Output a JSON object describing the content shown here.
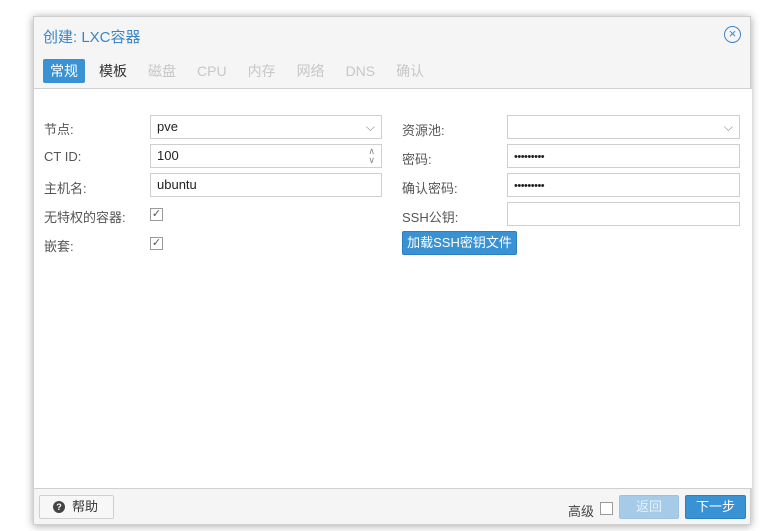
{
  "dialog": {
    "title": "创建: LXC容器",
    "close_glyph": "×",
    "tabs": [
      {
        "label": "常规",
        "active": true,
        "enabled": true
      },
      {
        "label": "模板",
        "active": false,
        "enabled": true
      },
      {
        "label": "磁盘",
        "active": false,
        "enabled": false
      },
      {
        "label": "CPU",
        "active": false,
        "enabled": false
      },
      {
        "label": "内存",
        "active": false,
        "enabled": false
      },
      {
        "label": "网络",
        "active": false,
        "enabled": false
      },
      {
        "label": "DNS",
        "active": false,
        "enabled": false
      },
      {
        "label": "确认",
        "active": false,
        "enabled": false
      }
    ]
  },
  "form": {
    "node_label": "节点:",
    "node_value": "pve",
    "ctid_label": "CT ID:",
    "ctid_value": "100",
    "hostname_label": "主机名:",
    "hostname_value": "ubuntu",
    "unprivileged_label": "无特权的容器:",
    "unprivileged_checked": true,
    "nesting_label": "嵌套:",
    "nesting_checked": true,
    "pool_label": "资源池:",
    "pool_value": "",
    "password_label": "密码:",
    "password_value": "•••••••••",
    "confirm_password_label": "确认密码:",
    "confirm_password_value": "•••••••••",
    "ssh_key_label": "SSH公钥:",
    "ssh_key_value": "",
    "load_ssh_button": "加载SSH密钥文件"
  },
  "footer": {
    "help_label": "帮助",
    "advanced_label": "高级",
    "advanced_checked": false,
    "back_label": "返回",
    "next_label": "下一步"
  },
  "colors": {
    "accent": "#3892d4",
    "title": "#3a85c7",
    "disabled_tab": "#c7c7c7"
  },
  "icons": {
    "close": "close-circle-icon",
    "dropdown": "chevron-down-icon",
    "spinner": "spinner-arrows-icon",
    "help": "question-circle-icon",
    "check": "checkmark-icon"
  }
}
